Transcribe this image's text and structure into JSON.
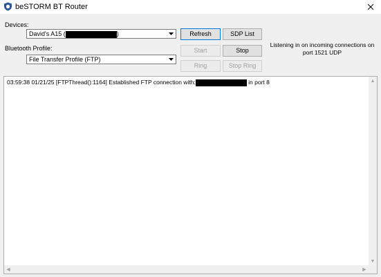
{
  "window": {
    "title": "beSTORM BT Router",
    "icon": "shield-icon",
    "close_icon": "close-icon"
  },
  "devices": {
    "label": "Devices:",
    "selected": "David's A15 (",
    "selected_suffix": ")"
  },
  "bluetooth_profile": {
    "label": "Bluetooth Profile:",
    "selected": "File Transfer Profile (FTP)"
  },
  "buttons": {
    "refresh": "Refresh",
    "sdp_list": "SDP List",
    "start": "Start",
    "stop": "Stop",
    "ring": "Ring",
    "stop_ring": "Stop Ring"
  },
  "status": {
    "line1": "Listening in on incoming connections on",
    "line2": "port 1521 UDP"
  },
  "log": {
    "line_prefix": "03:59:38 01/21/25 [FTPThread():1164] Established FTP connection with:",
    "line_suffix": "in port 8"
  },
  "colors": {
    "background": "#f0f0f0",
    "focus_border": "#0078d7",
    "redaction": "#000000"
  }
}
